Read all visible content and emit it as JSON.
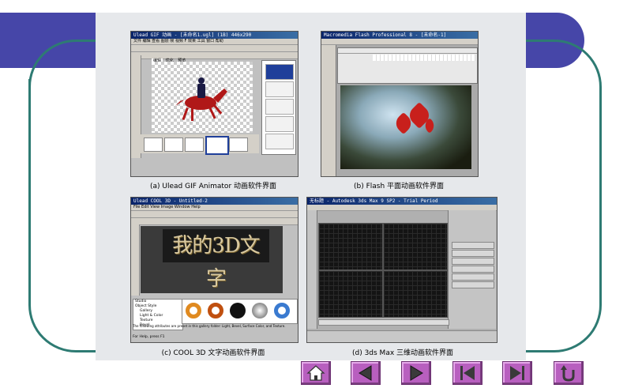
{
  "screenshots": {
    "ulead": {
      "title": "Ulead GIF 动画 - [未命名1.ugl] (1B) 446x290",
      "menu": "文件 编辑 查看 图层 帧 视频 F 效果 工具 窗口 帮助",
      "tabs": [
        "编辑",
        "优化",
        "预览"
      ],
      "caption": "(a)  Ulead  GIF  Animator  动画软件界面"
    },
    "flash": {
      "title": "Macromedia Flash Professional 8 - [未命名-1]",
      "caption": "(b)  Flash 平面动画软件界面"
    },
    "cool3d": {
      "title": "Ulead COOL 3D - Untitled-2",
      "menu": "File  Edit  View  Image  Window  Help",
      "canvas_text": "我的3D文字",
      "tree_items": [
        "Studio",
        "Object Style",
        "Gallery",
        "Light & Color",
        "Texture",
        "Bevel"
      ],
      "info_text": "The following attributes are preset in this gallery folder: Light, Bevel, Surface Color, and Texture.",
      "status": "For Help, press F1",
      "caption": "(c)  COOL  3D 文字动画软件界面"
    },
    "max": {
      "title": "无标题 - Autodesk 3ds Max 9 SP2 - Trial Period",
      "caption": "(d)  3ds  Max 三维动画软件界面"
    }
  },
  "nav_buttons": [
    {
      "name": "home",
      "icon": "home-icon"
    },
    {
      "name": "prev",
      "icon": "triangle-left-icon"
    },
    {
      "name": "next",
      "icon": "triangle-right-icon"
    },
    {
      "name": "first",
      "icon": "skip-first-icon"
    },
    {
      "name": "last",
      "icon": "skip-last-icon"
    },
    {
      "name": "return",
      "icon": "return-arrow-icon"
    }
  ],
  "colors": {
    "band": "#4646a8",
    "teal": "#2e7b73",
    "nav_button": "#b85fbf"
  }
}
